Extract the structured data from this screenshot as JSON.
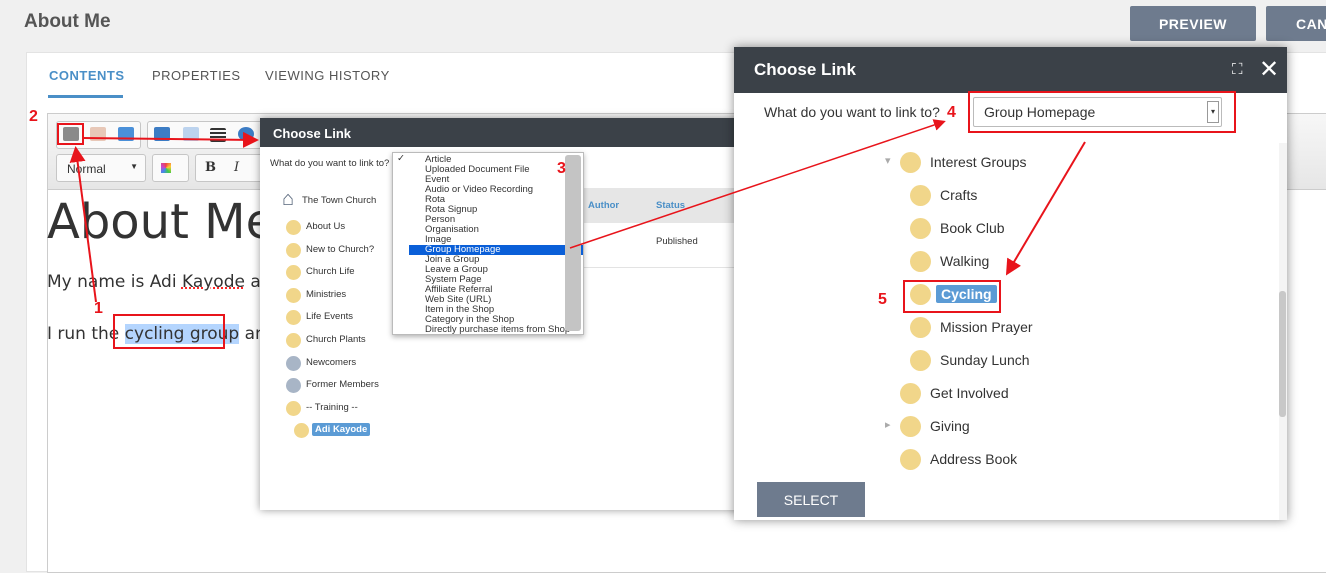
{
  "page": {
    "title": "About Me",
    "preview_label": "PREVIEW",
    "cancel_label": "CAN"
  },
  "tabs": [
    {
      "label": "CONTENTS",
      "active": true
    },
    {
      "label": "PROPERTIES"
    },
    {
      "label": "VIEWING HISTORY"
    }
  ],
  "editor": {
    "format_select": "Normal",
    "bold": "B",
    "italic": "I",
    "heading": "About Me",
    "para1_pre": "My name is Adi ",
    "para1_name": "Kayode",
    "para1_post": " an",
    "para2_pre": "I run the ",
    "para2_link": "cycling group",
    "para2_post": " and"
  },
  "dialog_small": {
    "title": "Choose Link",
    "question": "What do you want to link to?",
    "tree": [
      {
        "label": "The Town Church",
        "icon": "church-icon"
      },
      {
        "label": "About Us"
      },
      {
        "label": "New to Church?"
      },
      {
        "label": "Church Life"
      },
      {
        "label": "Ministries"
      },
      {
        "label": "Life Events"
      },
      {
        "label": "Church Plants"
      },
      {
        "label": "Newcomers",
        "icon": "person-icon"
      },
      {
        "label": "Former Members",
        "icon": "person-icon"
      },
      {
        "label": "-- Training --"
      },
      {
        "label": "Adi Kayode",
        "selected": true
      }
    ],
    "options": [
      "Article",
      "Uploaded Document File",
      "Event",
      "Audio or Video Recording",
      "Rota",
      "Rota Signup",
      "Person",
      "Organisation",
      "Image",
      "Group Homepage",
      "Join a Group",
      "Leave a Group",
      "System Page",
      "Affiliate Referral",
      "Web Site (URL)",
      "Item in the Shop",
      "Category in the Shop",
      "Directly purchase items from Shop"
    ],
    "checked_option": "Article",
    "highlighted_option": "Group Homepage",
    "table": {
      "headers": [
        "Author",
        "Status"
      ],
      "row_status": "Published"
    }
  },
  "dialog_large": {
    "title": "Choose Link",
    "question": "What do you want to link to?",
    "select_value": "Group Homepage",
    "tree": [
      {
        "label": "Interest Groups",
        "level": 0,
        "expanded": true
      },
      {
        "label": "Crafts",
        "level": 1
      },
      {
        "label": "Book Club",
        "level": 1
      },
      {
        "label": "Walking",
        "level": 1
      },
      {
        "label": "Cycling",
        "level": 1,
        "selected": true
      },
      {
        "label": "Mission Prayer",
        "level": 1
      },
      {
        "label": "Sunday Lunch",
        "level": 1
      },
      {
        "label": "Get Involved",
        "level": 0
      },
      {
        "label": "Giving",
        "level": 0,
        "collapsed": true
      },
      {
        "label": "Address Book",
        "level": 0
      }
    ],
    "select_button": "SELECT"
  },
  "annotations": [
    "1",
    "2",
    "3",
    "4",
    "5"
  ],
  "colors": {
    "accent": "#4a8fc7",
    "header": "#3b4148",
    "button": "#6e7b8e",
    "annotation": "#e8141b",
    "folder": "#f1d68a",
    "selected": "#5b9bd5"
  }
}
